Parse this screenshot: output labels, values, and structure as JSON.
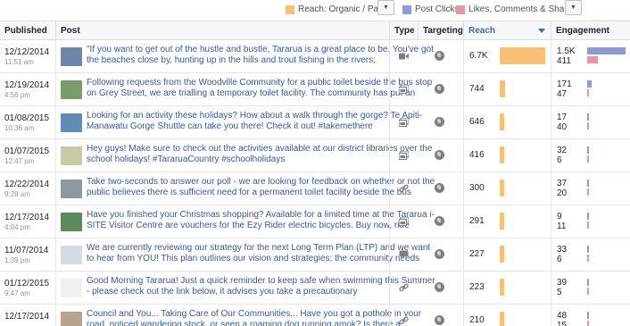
{
  "legend": {
    "reach_label": "Reach: Organic / Paid",
    "reach_color": "#f7c074",
    "clicks_label": "Post Clicks",
    "clicks_color": "#8c9bd1",
    "engagement_label": "Likes, Comments & Shares",
    "engagement_color": "#e895a7"
  },
  "columns": {
    "published": "Published",
    "post": "Post",
    "type": "Type",
    "targeting": "Targeting",
    "reach": "Reach",
    "engagement": "Engagement"
  },
  "max_reach": 6700,
  "max_eng": 1500,
  "rows": [
    {
      "date": "12/12/2014",
      "time": "11:51 am",
      "text": "\"If you want to get out of the hustle and bustle, Tararua is a great place to be. You've got the beaches close by, hunting up in the hills and trout fishing in the rivers;",
      "type": "video-icon",
      "reach": "6.7K",
      "reach_value": 6700,
      "eng_clicks": "1.5K",
      "eng_clicks_value": 1500,
      "eng_likes": "411",
      "eng_likes_value": 411,
      "thumb": "#6e86a8"
    },
    {
      "date": "12/19/2014",
      "time": "4:56 pm",
      "text": "Following requests from the Woodville Community for a public toilet beside the bus stop on Grey Street, we are trialling a temporary toilet facility. The community has put an",
      "type": "photo-icon",
      "reach": "744",
      "reach_value": 744,
      "eng_clicks": "171",
      "eng_clicks_value": 171,
      "eng_likes": "47",
      "eng_likes_value": 47,
      "thumb": "#7a9c6a"
    },
    {
      "date": "01/08/2015",
      "time": "10:36 am",
      "text": "Looking for an activity these holidays? How about a walk through the gorge? Te Apiti-Manawatu Gorge Shuttle can take you there! Check it out! #takemethere",
      "type": "photo-icon",
      "reach": "646",
      "reach_value": 646,
      "eng_clicks": "17",
      "eng_clicks_value": 17,
      "eng_likes": "40",
      "eng_likes_value": 40,
      "thumb": "#5f8bb5"
    },
    {
      "date": "01/07/2015",
      "time": "12:47 pm",
      "text": "Hey guys! Make sure to check out the activities available at our district libraries over the school holidays! #TararuaCountry #schoolholidays",
      "type": "photo-icon",
      "reach": "416",
      "reach_value": 416,
      "eng_clicks": "32",
      "eng_clicks_value": 32,
      "eng_likes": "6",
      "eng_likes_value": 6,
      "thumb": "#c9c9a8"
    },
    {
      "date": "12/22/2014",
      "time": "9:28 am",
      "text": "Take two-seconds to answer our poll - we are looking for feedback on whether or not the public believes there is sufficient need for a permanent toilet facility beside the bus",
      "type": "link-icon",
      "reach": "300",
      "reach_value": 300,
      "eng_clicks": "37",
      "eng_clicks_value": 37,
      "eng_likes": "20",
      "eng_likes_value": 20,
      "thumb": "#8d98a3"
    },
    {
      "date": "12/17/2014",
      "time": "4:04 pm",
      "text": "Have you finished your Christmas shopping? Available for a limited time at the Tararua i-SITE Visitor Centre are vouchers for the Ezy Rider electric bicycles. Buy now, ride",
      "type": "photo-icon",
      "reach": "291",
      "reach_value": 291,
      "eng_clicks": "9",
      "eng_clicks_value": 9,
      "eng_likes": "11",
      "eng_likes_value": 11,
      "thumb": "#5e8a5a"
    },
    {
      "date": "11/07/2014",
      "time": "1:39 pm",
      "text": "We are currently reviewing our strategy for the next Long Term Plan (LTP) and we want to hear from YOU! This plan outlines our vision and strategies; the community needs",
      "type": "status-icon",
      "reach": "227",
      "reach_value": 227,
      "eng_clicks": "33",
      "eng_clicks_value": 33,
      "eng_likes": "6",
      "eng_likes_value": 6,
      "thumb": "#d6dbe3"
    },
    {
      "date": "01/12/2015",
      "time": "9:47 am",
      "text": "Good Morning Tararua! Just a quick reminder to keep safe when swimming this Summer - please check out the link below, it advises you take a precautionary",
      "type": "link-icon",
      "reach": "223",
      "reach_value": 223,
      "eng_clicks": "39",
      "eng_clicks_value": 39,
      "eng_likes": "5",
      "eng_likes_value": 5,
      "thumb": "#f0f0f0"
    },
    {
      "date": "12/17/2014",
      "time": "",
      "text": "Council and You... Taking Care of Our Communities... Have you got a pothole in your road, noticed wandering stock, or seen a roaming dog running amok? Is there a",
      "type": "link-icon",
      "reach": "210",
      "reach_value": 210,
      "eng_clicks": "48",
      "eng_clicks_value": 48,
      "eng_likes": "15",
      "eng_likes_value": 15,
      "thumb": "#b8a48c"
    }
  ]
}
